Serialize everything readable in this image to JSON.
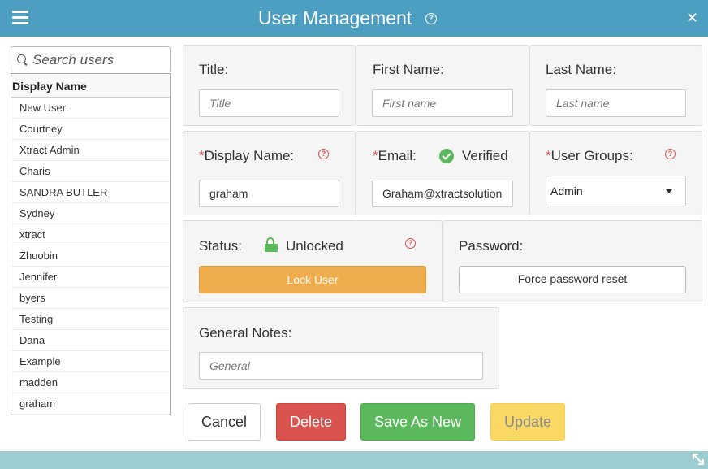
{
  "window": {
    "title": "User Management",
    "help_glyph": "?",
    "close_glyph": "✕",
    "menu_icon": "hamburger-icon",
    "resize_icon": "resize-diagonal-icon"
  },
  "sidebar": {
    "search_placeholder": "Search users",
    "list_header": "Display Name",
    "users": [
      "New User",
      "Courtney",
      "Xtract Admin",
      "Charis",
      "SANDRA BUTLER",
      "Sydney",
      "xtract",
      "Zhuobin",
      "Jennifer",
      "byers",
      "Testing",
      "Dana",
      "Example",
      "madden",
      "graham"
    ]
  },
  "form": {
    "title": {
      "label": "Title:",
      "value": "",
      "placeholder": "Title"
    },
    "first_name": {
      "label": "First Name:",
      "value": "",
      "placeholder": "First name"
    },
    "last_name": {
      "label": "Last Name:",
      "value": "",
      "placeholder": "Last name"
    },
    "display_name": {
      "required_mark": "*",
      "label": "Display Name:",
      "value": "graham"
    },
    "email": {
      "required_mark": "*",
      "label": "Email:",
      "verified_text": "Verified",
      "value": "Graham@xtractsolution"
    },
    "user_groups": {
      "required_mark": "*",
      "label": "User Groups:",
      "selected": "Admin"
    },
    "status": {
      "label": "Status:",
      "value": "Unlocked",
      "button": "Lock User"
    },
    "password": {
      "label": "Password:",
      "button": "Force password reset"
    },
    "notes": {
      "label": "General Notes:",
      "value": "",
      "placeholder": "General"
    },
    "help_glyph": "?"
  },
  "actions": {
    "cancel": "Cancel",
    "delete": "Delete",
    "save_as_new": "Save As New",
    "update": "Update"
  },
  "colors": {
    "titlebar": "#4d9fc1",
    "bottombar": "#9cced1",
    "required": "#d9534f",
    "verified": "#5cb85c",
    "lock_button": "#f0ad4e",
    "delete_button": "#d9534f",
    "save_button": "#5cb85c",
    "update_button": "#fad864"
  }
}
